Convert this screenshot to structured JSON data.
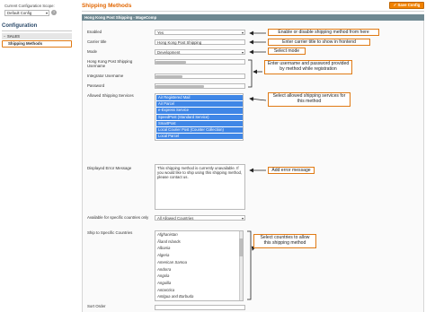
{
  "sidebar": {
    "scope_label": "Current Configuration Scope:",
    "scope_value": "Default Config",
    "scope_help": "?",
    "title": "Configuration",
    "group_label": "SALES",
    "group_marker": "−",
    "active_item": "Shipping Methods"
  },
  "header": {
    "title": "Shipping Methods",
    "save_label": "Save Config",
    "section_title": "Hong Kong Post Shipping - MageComp"
  },
  "form": {
    "enabled_label": "Enabled",
    "enabled_value": "Yes",
    "carrier_title_label": "Carrier title",
    "carrier_title_value": "Hong Kong Post Shipping",
    "mode_label": "Mode",
    "mode_value": "Development",
    "username_label": "Hong Kong Post Shipping Username",
    "integrator_label": "Integrator Username",
    "password_label": "Password",
    "allowed_label": "Allowed Shipping Services",
    "services": [
      "Air Registered Mail",
      "Air Parcel",
      "e-Express Service",
      "SpeedPost (Standard Service)",
      "SmartPost",
      "Local Courier Post (Counter Collection)",
      "Local Parcel"
    ],
    "error_label": "Displayed Error Message",
    "error_value": "This shipping method is currently unavailable. If you would like to ship using this shipping method, please contact us.",
    "countries_label": "Available for specific countries only",
    "countries_value": "All Allowed Countries",
    "ship_to_label": "Ship to Specific Countries",
    "country_list": [
      "Afghanistan",
      "Åland Islands",
      "Albania",
      "Algeria",
      "American Samoa",
      "Andorra",
      "Angola",
      "Anguilla",
      "Antarctica",
      "Antigua and Barbuda"
    ],
    "sort_order_label": "Sort Order"
  },
  "annotations": {
    "enable": "Enable or disable shipping method from here",
    "carrier": "Enter carrier title to show in frontend",
    "mode": "Select mode",
    "credentials": "Enter username and password provided by method while registration",
    "services": "Select allowed shipping services for this method",
    "error": "Add error message",
    "countries": "Select countries to allow this shipping method"
  },
  "colors": {
    "accent": "#e07a14",
    "section_header": "#6f8992",
    "selected": "#3f86e6"
  }
}
